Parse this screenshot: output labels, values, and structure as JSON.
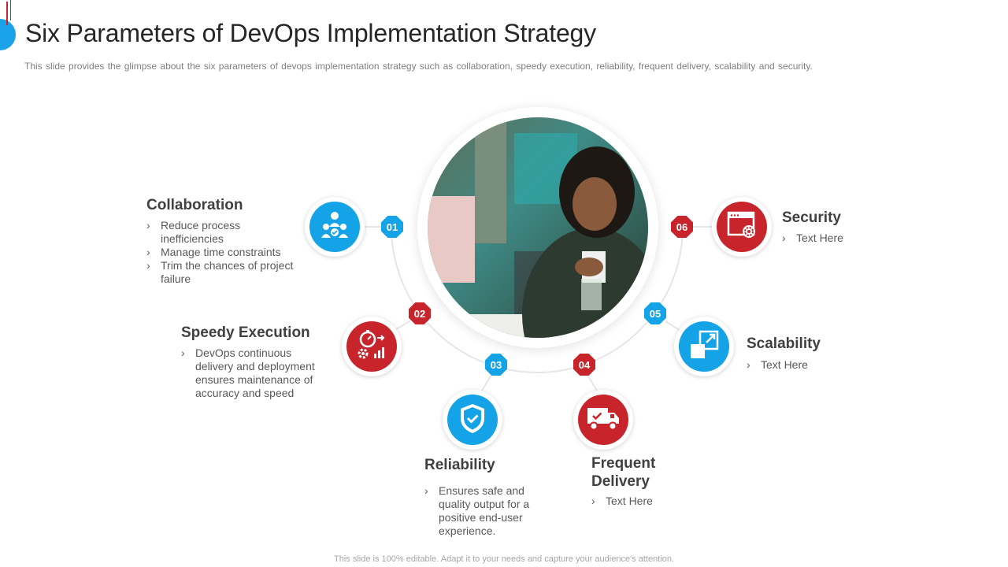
{
  "header": {
    "title": "Six Parameters of DevOps Implementation Strategy",
    "subtitle": "This slide provides  the glimpse about the six parameters  of devops  implementation strategy such as collaboration,  speedy execution, reliability, frequent  delivery,  scalability and security."
  },
  "footer": {
    "text": "This slide is 100% editable. Adapt it to your needs and capture your audience's attention."
  },
  "colors": {
    "blue": "#14a3e6",
    "red": "#c8242b",
    "text": "#404040"
  },
  "params": [
    {
      "number": "01",
      "title": "Collaboration",
      "icon": "team-icon",
      "color": "blue",
      "bullets": [
        "Reduce process inefficiencies",
        "Manage time constraints",
        "Trim the chances of project failure"
      ]
    },
    {
      "number": "02",
      "title": "Speedy Execution",
      "icon": "speed-gears-icon",
      "color": "red",
      "bullets": [
        "DevOps continuous delivery and deployment ensures maintenance of accuracy and speed"
      ]
    },
    {
      "number": "03",
      "title": "Reliability",
      "icon": "shield-check-icon",
      "color": "blue",
      "bullets": [
        "Ensures safe and quality output for a positive end-user experience."
      ]
    },
    {
      "number": "04",
      "title": "Frequent Delivery",
      "icon": "delivery-truck-icon",
      "color": "red",
      "bullets": [
        "Text Here"
      ]
    },
    {
      "number": "05",
      "title": "Scalability",
      "icon": "scale-expand-icon",
      "color": "blue",
      "bullets": [
        "Text Here"
      ]
    },
    {
      "number": "06",
      "title": "Security",
      "icon": "browser-gear-icon",
      "color": "red",
      "bullets": [
        "Text Here"
      ]
    }
  ]
}
